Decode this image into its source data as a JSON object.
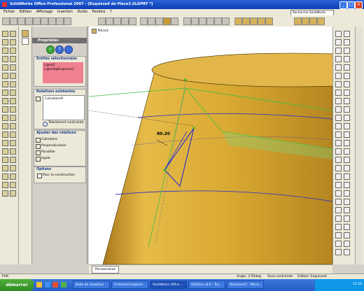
{
  "window": {
    "title": "SolidWorks Office Professional 2007 - [Esquisse4 de Pièce3.SLDPRT *]",
    "search_label": "Recherche SolidWorks"
  },
  "menu": [
    "Fichier",
    "Edition",
    "Affichage",
    "Insertion",
    "Outils",
    "Fenêtre",
    "?"
  ],
  "tree": {
    "part_label": "Pièce3"
  },
  "panel": {
    "title": "Propriétés",
    "selected_entities": {
      "heading": "Entités sélectionnées",
      "items": [
        "Ligne2",
        "Ligne9@Esquisse1"
      ]
    },
    "existing_relations": {
      "heading": "Relations existantes",
      "items": [
        "Colinéaire9"
      ],
      "status": "Totalement contrainte"
    },
    "add_relations": {
      "heading": "Ajouter des relations",
      "items": [
        "Colinéaire",
        "Perpendiculaire",
        "Parallèle",
        "Egale"
      ]
    },
    "options": {
      "heading": "Options",
      "checkbox_label": "Pour la construction"
    }
  },
  "viewport": {
    "dimension_label": "80.20"
  },
  "sheet_tab": {
    "label": "Personnalisé"
  },
  "status": {
    "left": "Prêt",
    "angle": "Angle: 3.55deg",
    "constraint": "Sous-contrainte",
    "edit": "Edition: Esquisse4"
  },
  "taskbar": {
    "start_label": "démarrer",
    "tasks": [
      "Boîte de réception ...",
      "4 Internet Explorer",
      "SolidWorks Office ...",
      "ACDSee v4.0 - Tut...",
      "Document1 - Micro..."
    ],
    "clock": "12:29"
  },
  "colors": {
    "cylinder": "#d9a932",
    "pink_selection": "#f08090",
    "title_blue": "#0b3fb6"
  }
}
